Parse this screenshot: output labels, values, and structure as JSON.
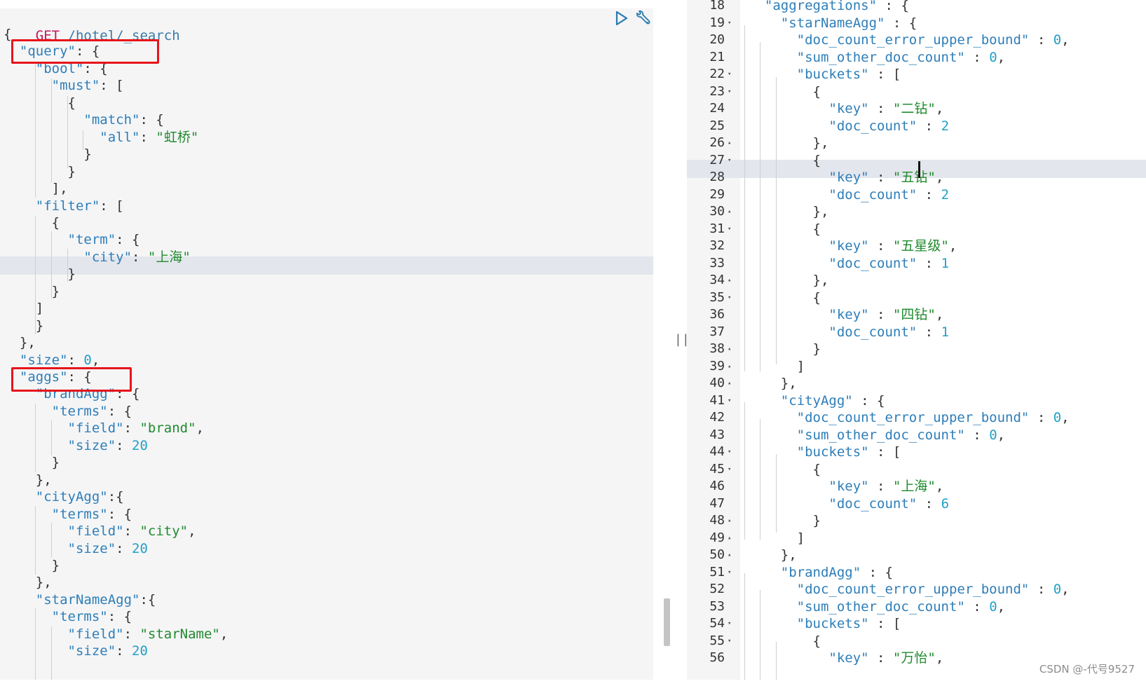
{
  "request": {
    "method": "GET",
    "path": " /hotel/_search"
  },
  "left_lines": [
    [
      [
        "p",
        "{"
      ]
    ],
    [
      [
        "p",
        "  "
      ],
      [
        "k",
        "\"query\""
      ],
      [
        "p",
        ": {"
      ]
    ],
    [
      [
        "p",
        "    "
      ],
      [
        "k",
        "\"bool\""
      ],
      [
        "p",
        ": {"
      ]
    ],
    [
      [
        "p",
        "      "
      ],
      [
        "k",
        "\"must\""
      ],
      [
        "p",
        ": ["
      ]
    ],
    [
      [
        "p",
        "        {"
      ]
    ],
    [
      [
        "p",
        "          "
      ],
      [
        "k",
        "\"match\""
      ],
      [
        "p",
        ": {"
      ]
    ],
    [
      [
        "p",
        "            "
      ],
      [
        "k",
        "\"all\""
      ],
      [
        "p",
        ": "
      ],
      [
        "s",
        "\"虹桥\""
      ]
    ],
    [
      [
        "p",
        "          }"
      ]
    ],
    [
      [
        "p",
        "        }"
      ]
    ],
    [
      [
        "p",
        "      ],"
      ]
    ],
    [
      [
        "p",
        "    "
      ],
      [
        "k",
        "\"filter\""
      ],
      [
        "p",
        ": ["
      ]
    ],
    [
      [
        "p",
        "      {"
      ]
    ],
    [
      [
        "p",
        "        "
      ],
      [
        "k",
        "\"term\""
      ],
      [
        "p",
        ": {"
      ]
    ],
    [
      [
        "p",
        "          "
      ],
      [
        "k",
        "\"city\""
      ],
      [
        "p",
        ": "
      ],
      [
        "s",
        "\"上海\""
      ]
    ],
    [
      [
        "p",
        "        }"
      ]
    ],
    [
      [
        "p",
        "      }"
      ]
    ],
    [
      [
        "p",
        "    ]"
      ]
    ],
    [
      [
        "p",
        "    }"
      ]
    ],
    [
      [
        "p",
        "  },"
      ]
    ],
    [
      [
        "p",
        "  "
      ],
      [
        "k",
        "\"size\""
      ],
      [
        "p",
        ": "
      ],
      [
        "n",
        "0"
      ],
      [
        "p",
        ","
      ]
    ],
    [
      [
        "p",
        "  "
      ],
      [
        "k",
        "\"aggs\""
      ],
      [
        "p",
        ": {"
      ]
    ],
    [
      [
        "p",
        "    "
      ],
      [
        "k",
        "\"brandAgg\""
      ],
      [
        "p",
        ": {"
      ]
    ],
    [
      [
        "p",
        "      "
      ],
      [
        "k",
        "\"terms\""
      ],
      [
        "p",
        ": {"
      ]
    ],
    [
      [
        "p",
        "        "
      ],
      [
        "k",
        "\"field\""
      ],
      [
        "p",
        ": "
      ],
      [
        "s",
        "\"brand\""
      ],
      [
        "p",
        ","
      ]
    ],
    [
      [
        "p",
        "        "
      ],
      [
        "k",
        "\"size\""
      ],
      [
        "p",
        ": "
      ],
      [
        "n",
        "20"
      ]
    ],
    [
      [
        "p",
        "      }"
      ]
    ],
    [
      [
        "p",
        "    },"
      ]
    ],
    [
      [
        "p",
        "    "
      ],
      [
        "k",
        "\"cityAgg\""
      ],
      [
        "p",
        ":{"
      ]
    ],
    [
      [
        "p",
        "      "
      ],
      [
        "k",
        "\"terms\""
      ],
      [
        "p",
        ": {"
      ]
    ],
    [
      [
        "p",
        "        "
      ],
      [
        "k",
        "\"field\""
      ],
      [
        "p",
        ": "
      ],
      [
        "s",
        "\"city\""
      ],
      [
        "p",
        ","
      ]
    ],
    [
      [
        "p",
        "        "
      ],
      [
        "k",
        "\"size\""
      ],
      [
        "p",
        ": "
      ],
      [
        "n",
        "20"
      ]
    ],
    [
      [
        "p",
        "      }"
      ]
    ],
    [
      [
        "p",
        "    },"
      ]
    ],
    [
      [
        "p",
        "    "
      ],
      [
        "k",
        "\"starNameAgg\""
      ],
      [
        "p",
        ":{"
      ]
    ],
    [
      [
        "p",
        "      "
      ],
      [
        "k",
        "\"terms\""
      ],
      [
        "p",
        ": {"
      ]
    ],
    [
      [
        "p",
        "        "
      ],
      [
        "k",
        "\"field\""
      ],
      [
        "p",
        ": "
      ],
      [
        "s",
        "\"starName\""
      ],
      [
        "p",
        ","
      ]
    ],
    [
      [
        "p",
        "        "
      ],
      [
        "k",
        "\"size\""
      ],
      [
        "p",
        ": "
      ],
      [
        "n",
        "20"
      ]
    ]
  ],
  "right_lines": [
    {
      "n": "18",
      "f": "",
      "t": [
        [
          "p",
          "  "
        ],
        [
          "k",
          "\"aggregations\""
        ],
        [
          "p",
          " : {"
        ]
      ]
    },
    {
      "n": "19",
      "f": "▾",
      "t": [
        [
          "p",
          "    "
        ],
        [
          "k",
          "\"starNameAgg\""
        ],
        [
          "p",
          " : {"
        ]
      ]
    },
    {
      "n": "20",
      "f": "",
      "t": [
        [
          "p",
          "      "
        ],
        [
          "k",
          "\"doc_count_error_upper_bound\""
        ],
        [
          "p",
          " : "
        ],
        [
          "n",
          "0"
        ],
        [
          "p",
          ","
        ]
      ]
    },
    {
      "n": "21",
      "f": "",
      "t": [
        [
          "p",
          "      "
        ],
        [
          "k",
          "\"sum_other_doc_count\""
        ],
        [
          "p",
          " : "
        ],
        [
          "n",
          "0"
        ],
        [
          "p",
          ","
        ]
      ]
    },
    {
      "n": "22",
      "f": "▾",
      "t": [
        [
          "p",
          "      "
        ],
        [
          "k",
          "\"buckets\""
        ],
        [
          "p",
          " : ["
        ]
      ]
    },
    {
      "n": "23",
      "f": "▾",
      "t": [
        [
          "p",
          "        {"
        ]
      ]
    },
    {
      "n": "24",
      "f": "",
      "t": [
        [
          "p",
          "          "
        ],
        [
          "k",
          "\"key\""
        ],
        [
          "p",
          " : "
        ],
        [
          "s",
          "\"二钻\""
        ],
        [
          "p",
          ","
        ]
      ]
    },
    {
      "n": "25",
      "f": "",
      "t": [
        [
          "p",
          "          "
        ],
        [
          "k",
          "\"doc_count\""
        ],
        [
          "p",
          " : "
        ],
        [
          "n",
          "2"
        ]
      ]
    },
    {
      "n": "26",
      "f": "▴",
      "t": [
        [
          "p",
          "        },"
        ]
      ]
    },
    {
      "n": "27",
      "f": "▾",
      "t": [
        [
          "p",
          "        {"
        ]
      ]
    },
    {
      "n": "28",
      "f": "",
      "t": [
        [
          "p",
          "          "
        ],
        [
          "k",
          "\"key\""
        ],
        [
          "p",
          " : "
        ],
        [
          "s",
          "\"五钻\""
        ],
        [
          "p",
          ","
        ]
      ]
    },
    {
      "n": "29",
      "f": "",
      "t": [
        [
          "p",
          "          "
        ],
        [
          "k",
          "\"doc_count\""
        ],
        [
          "p",
          " : "
        ],
        [
          "n",
          "2"
        ]
      ]
    },
    {
      "n": "30",
      "f": "▴",
      "t": [
        [
          "p",
          "        },"
        ]
      ]
    },
    {
      "n": "31",
      "f": "▾",
      "t": [
        [
          "p",
          "        {"
        ]
      ]
    },
    {
      "n": "32",
      "f": "",
      "t": [
        [
          "p",
          "          "
        ],
        [
          "k",
          "\"key\""
        ],
        [
          "p",
          " : "
        ],
        [
          "s",
          "\"五星级\""
        ],
        [
          "p",
          ","
        ]
      ]
    },
    {
      "n": "33",
      "f": "",
      "t": [
        [
          "p",
          "          "
        ],
        [
          "k",
          "\"doc_count\""
        ],
        [
          "p",
          " : "
        ],
        [
          "n",
          "1"
        ]
      ]
    },
    {
      "n": "34",
      "f": "▴",
      "t": [
        [
          "p",
          "        },"
        ]
      ]
    },
    {
      "n": "35",
      "f": "▾",
      "t": [
        [
          "p",
          "        {"
        ]
      ]
    },
    {
      "n": "36",
      "f": "",
      "t": [
        [
          "p",
          "          "
        ],
        [
          "k",
          "\"key\""
        ],
        [
          "p",
          " : "
        ],
        [
          "s",
          "\"四钻\""
        ],
        [
          "p",
          ","
        ]
      ]
    },
    {
      "n": "37",
      "f": "",
      "t": [
        [
          "p",
          "          "
        ],
        [
          "k",
          "\"doc_count\""
        ],
        [
          "p",
          " : "
        ],
        [
          "n",
          "1"
        ]
      ]
    },
    {
      "n": "38",
      "f": "▴",
      "t": [
        [
          "p",
          "        }"
        ]
      ]
    },
    {
      "n": "39",
      "f": "▴",
      "t": [
        [
          "p",
          "      ]"
        ]
      ]
    },
    {
      "n": "40",
      "f": "▴",
      "t": [
        [
          "p",
          "    },"
        ]
      ]
    },
    {
      "n": "41",
      "f": "▾",
      "t": [
        [
          "p",
          "    "
        ],
        [
          "k",
          "\"cityAgg\""
        ],
        [
          "p",
          " : {"
        ]
      ]
    },
    {
      "n": "42",
      "f": "",
      "t": [
        [
          "p",
          "      "
        ],
        [
          "k",
          "\"doc_count_error_upper_bound\""
        ],
        [
          "p",
          " : "
        ],
        [
          "n",
          "0"
        ],
        [
          "p",
          ","
        ]
      ]
    },
    {
      "n": "43",
      "f": "",
      "t": [
        [
          "p",
          "      "
        ],
        [
          "k",
          "\"sum_other_doc_count\""
        ],
        [
          "p",
          " : "
        ],
        [
          "n",
          "0"
        ],
        [
          "p",
          ","
        ]
      ]
    },
    {
      "n": "44",
      "f": "▾",
      "t": [
        [
          "p",
          "      "
        ],
        [
          "k",
          "\"buckets\""
        ],
        [
          "p",
          " : ["
        ]
      ]
    },
    {
      "n": "45",
      "f": "▾",
      "t": [
        [
          "p",
          "        {"
        ]
      ]
    },
    {
      "n": "46",
      "f": "",
      "t": [
        [
          "p",
          "          "
        ],
        [
          "k",
          "\"key\""
        ],
        [
          "p",
          " : "
        ],
        [
          "s",
          "\"上海\""
        ],
        [
          "p",
          ","
        ]
      ]
    },
    {
      "n": "47",
      "f": "",
      "t": [
        [
          "p",
          "          "
        ],
        [
          "k",
          "\"doc_count\""
        ],
        [
          "p",
          " : "
        ],
        [
          "n",
          "6"
        ]
      ]
    },
    {
      "n": "48",
      "f": "▴",
      "t": [
        [
          "p",
          "        }"
        ]
      ]
    },
    {
      "n": "49",
      "f": "▴",
      "t": [
        [
          "p",
          "      ]"
        ]
      ]
    },
    {
      "n": "50",
      "f": "▴",
      "t": [
        [
          "p",
          "    },"
        ]
      ]
    },
    {
      "n": "51",
      "f": "▾",
      "t": [
        [
          "p",
          "    "
        ],
        [
          "k",
          "\"brandAgg\""
        ],
        [
          "p",
          " : {"
        ]
      ]
    },
    {
      "n": "52",
      "f": "",
      "t": [
        [
          "p",
          "      "
        ],
        [
          "k",
          "\"doc_count_error_upper_bound\""
        ],
        [
          "p",
          " : "
        ],
        [
          "n",
          "0"
        ],
        [
          "p",
          ","
        ]
      ]
    },
    {
      "n": "53",
      "f": "",
      "t": [
        [
          "p",
          "      "
        ],
        [
          "k",
          "\"sum_other_doc_count\""
        ],
        [
          "p",
          " : "
        ],
        [
          "n",
          "0"
        ],
        [
          "p",
          ","
        ]
      ]
    },
    {
      "n": "54",
      "f": "▾",
      "t": [
        [
          "p",
          "      "
        ],
        [
          "k",
          "\"buckets\""
        ],
        [
          "p",
          " : ["
        ]
      ]
    },
    {
      "n": "55",
      "f": "▾",
      "t": [
        [
          "p",
          "        {"
        ]
      ]
    },
    {
      "n": "56",
      "f": "",
      "t": [
        [
          "p",
          "          "
        ],
        [
          "k",
          "\"key\""
        ],
        [
          "p",
          " : "
        ],
        [
          "s",
          "\"万怡\""
        ],
        [
          "p",
          ","
        ]
      ]
    }
  ],
  "split_handle": "||",
  "watermark": "CSDN @-代号9527",
  "colors": {
    "key": "#2e7eb8",
    "string": "#1f8a2d",
    "number": "#22a0c8",
    "method": "#c2185b",
    "highlight_box": "#e8141b",
    "active_line": "#e3e6ec"
  },
  "icons": [
    "play-icon",
    "wrench-icon"
  ]
}
